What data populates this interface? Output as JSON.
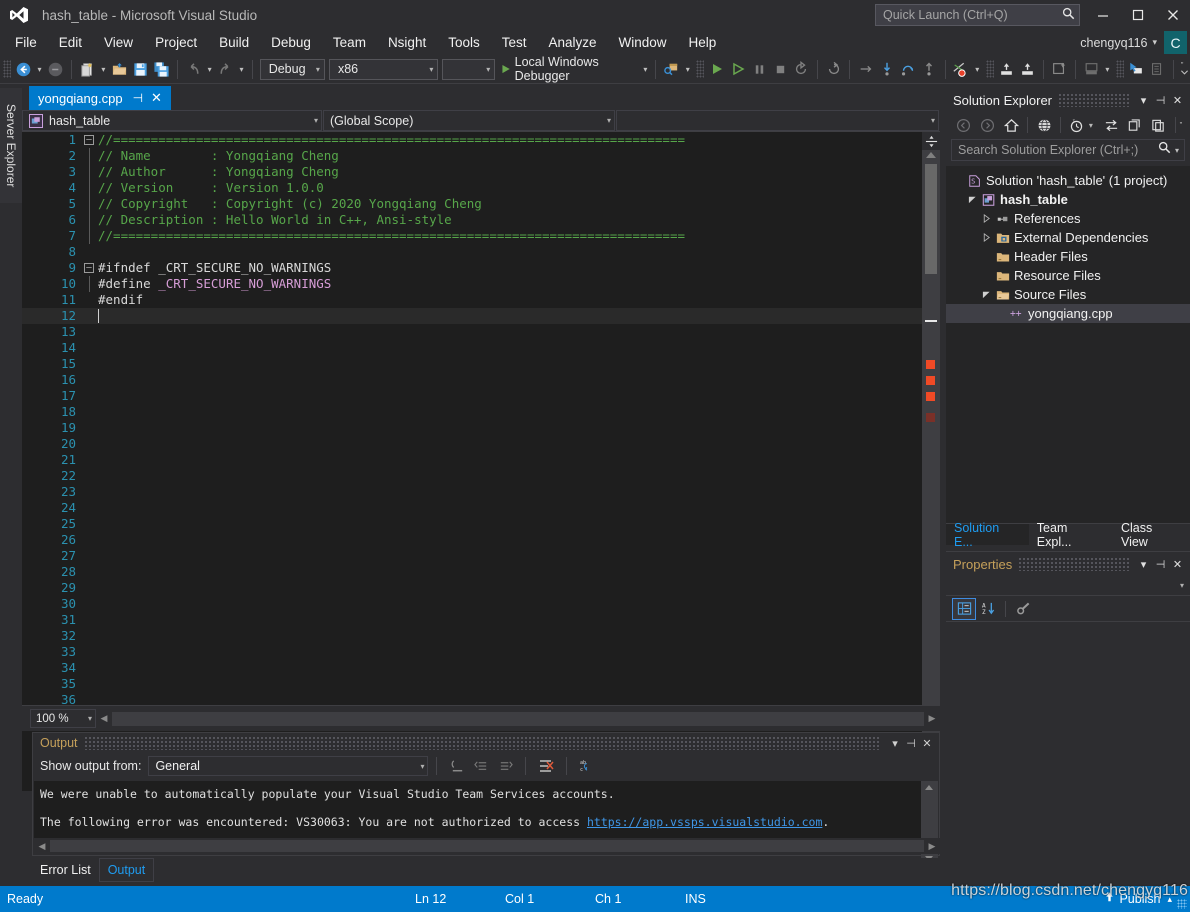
{
  "titlebar": {
    "title": "hash_table - Microsoft Visual Studio",
    "logo_icon": "visual-studio-logo-icon",
    "quick_launch_placeholder": "Quick Launch (Ctrl+Q)",
    "quick_launch_value": "",
    "search_icon": "search-icon",
    "minimize_icon": "minimize-icon",
    "maximize_icon": "maximize-icon",
    "close_icon": "close-icon"
  },
  "menubar": {
    "items": [
      {
        "label": "File"
      },
      {
        "label": "Edit"
      },
      {
        "label": "View"
      },
      {
        "label": "Project"
      },
      {
        "label": "Build"
      },
      {
        "label": "Debug"
      },
      {
        "label": "Team"
      },
      {
        "label": "Nsight"
      },
      {
        "label": "Tools"
      },
      {
        "label": "Test"
      },
      {
        "label": "Analyze"
      },
      {
        "label": "Window"
      },
      {
        "label": "Help"
      }
    ],
    "user_name": "chengyq116",
    "user_caret": "▾",
    "avatar_initial": "C"
  },
  "toolbar": {
    "nav_back_icon": "navigate-back-icon",
    "nav_forward_icon": "navigate-forward-icon",
    "new_project_icon": "new-project-icon",
    "open_file_icon": "open-file-icon",
    "save_icon": "save-icon",
    "save_all_icon": "save-all-icon",
    "undo_icon": "undo-icon",
    "redo_icon": "redo-icon",
    "config_value": "Debug",
    "platform_value": "x86",
    "extra_combo_value": "",
    "run_label": "Local Windows Debugger",
    "run_icon": "start-debug-icon",
    "attach_icon": "attach-to-process-icon",
    "start_icon": "start-icon",
    "start_no_debug_icon": "start-without-debugging-icon",
    "pause_icon": "pause-icon",
    "stop_icon": "stop-icon",
    "restart_icon": "restart-icon",
    "refresh_icon": "refresh-icon",
    "step_over_icon": "step-over-icon",
    "step_into_icon": "step-into-icon",
    "step_out_icon": "step-out-icon",
    "breakpoint_icon": "toggle-breakpoint-icon",
    "indent_in_icon": "indent-icon",
    "indent_out_icon": "outdent-icon",
    "comment_icon": "comment-icon",
    "uncomment_icon": "uncomment-icon",
    "bookmark_icon": "bookmark-icon",
    "list_icon": "list-icon",
    "windows_icon": "windows-icon",
    "misc_icon": "misc-icon"
  },
  "left_dock": {
    "server_explorer_label": "Server Explorer"
  },
  "editor": {
    "tab_name": "yongqiang.cpp",
    "tab_pin_icon": "pin-icon",
    "tab_close_icon": "close-icon",
    "nav_class": "hash_table",
    "nav_class_icon": "class-icon",
    "nav_member": "(Global Scope)",
    "nav_third": "",
    "caret_symbol": "▾",
    "zoom_level": "100 %",
    "scroll_split_icon": "split-view-icon",
    "lines": [
      {
        "n": 1,
        "text": "//============================================================================",
        "cls": "c-comment",
        "fold": "minus"
      },
      {
        "n": 2,
        "text": "// Name        : Yongqiang Cheng",
        "cls": "c-comment",
        "bar": true
      },
      {
        "n": 3,
        "text": "// Author      : Yongqiang Cheng",
        "cls": "c-comment",
        "bar": true
      },
      {
        "n": 4,
        "text": "// Version     : Version 1.0.0",
        "cls": "c-comment",
        "bar": true
      },
      {
        "n": 5,
        "text": "// Copyright   : Copyright (c) 2020 Yongqiang Cheng",
        "cls": "c-comment",
        "bar": true
      },
      {
        "n": 6,
        "text": "// Description : Hello World in C++, Ansi-style",
        "cls": "c-comment",
        "bar": true
      },
      {
        "n": 7,
        "text": "//============================================================================",
        "cls": "c-comment",
        "bar": true
      },
      {
        "n": 8,
        "text": "",
        "cls": "c-pp"
      },
      {
        "n": 9,
        "text": "#ifndef _CRT_SECURE_NO_WARNINGS",
        "cls": "c-pp",
        "fold": "minus"
      },
      {
        "n": 10,
        "text": "#define ",
        "cls": "c-pp",
        "macro": "_CRT_SECURE_NO_WARNINGS",
        "bar": true
      },
      {
        "n": 11,
        "text": "#endif",
        "cls": "c-pp"
      },
      {
        "n": 12,
        "text": "",
        "cls": "c-pp",
        "current": true
      },
      {
        "n": 13,
        "text": ""
      },
      {
        "n": 14,
        "text": ""
      },
      {
        "n": 15,
        "text": ""
      },
      {
        "n": 16,
        "text": ""
      },
      {
        "n": 17,
        "text": ""
      },
      {
        "n": 18,
        "text": ""
      },
      {
        "n": 19,
        "text": ""
      },
      {
        "n": 20,
        "text": ""
      },
      {
        "n": 21,
        "text": ""
      },
      {
        "n": 22,
        "text": ""
      },
      {
        "n": 23,
        "text": ""
      },
      {
        "n": 24,
        "text": ""
      },
      {
        "n": 25,
        "text": ""
      },
      {
        "n": 26,
        "text": ""
      },
      {
        "n": 27,
        "text": ""
      },
      {
        "n": 28,
        "text": ""
      },
      {
        "n": 29,
        "text": ""
      },
      {
        "n": 30,
        "text": ""
      },
      {
        "n": 31,
        "text": ""
      },
      {
        "n": 32,
        "text": ""
      },
      {
        "n": 33,
        "text": ""
      },
      {
        "n": 34,
        "text": ""
      },
      {
        "n": 35,
        "text": ""
      },
      {
        "n": 36,
        "text": ""
      }
    ]
  },
  "solution_explorer": {
    "title": "Solution Explorer",
    "dropdown_icon": "chevron-down-icon",
    "pin_icon": "pin-icon",
    "close_icon": "close-icon",
    "back_icon": "back-icon",
    "forward_icon": "forward-icon",
    "home_icon": "home-icon",
    "all_files_icon": "show-all-files-icon",
    "pending_changes_icon": "pending-changes-icon",
    "sync_icon": "sync-with-active-document-icon",
    "refresh_icon": "refresh-icon",
    "properties_icon": "properties-icon",
    "overflow_icon": "overflow-icon",
    "search_placeholder": "Search Solution Explorer (Ctrl+;)",
    "search_value": "",
    "search_icon": "search-icon",
    "search_caret": "▾",
    "tree": [
      {
        "label": "Solution 'hash_table' (1 project)",
        "indent": 0,
        "expander": "",
        "icon": "solution-icon",
        "bold": false,
        "selected": false
      },
      {
        "label": "hash_table",
        "indent": 1,
        "expander": "expanded",
        "icon": "cpp-project-icon",
        "bold": true,
        "selected": false
      },
      {
        "label": "References",
        "indent": 2,
        "expander": "collapsed",
        "icon": "references-icon",
        "bold": false,
        "selected": false
      },
      {
        "label": "External Dependencies",
        "indent": 2,
        "expander": "collapsed",
        "icon": "folder-dep-icon",
        "bold": false,
        "selected": false
      },
      {
        "label": "Header Files",
        "indent": 2,
        "expander": "",
        "icon": "folder-filter-icon",
        "bold": false,
        "selected": false
      },
      {
        "label": "Resource Files",
        "indent": 2,
        "expander": "",
        "icon": "folder-filter-icon",
        "bold": false,
        "selected": false
      },
      {
        "label": "Source Files",
        "indent": 2,
        "expander": "expanded",
        "icon": "folder-filter-open-icon",
        "bold": false,
        "selected": false
      },
      {
        "label": "yongqiang.cpp",
        "indent": 3,
        "expander": "",
        "icon": "cpp-file-icon",
        "bold": false,
        "selected": true
      }
    ],
    "tabs": [
      {
        "label": "Solution E...",
        "active": true
      },
      {
        "label": "Team Expl...",
        "active": false
      },
      {
        "label": "Class View",
        "active": false
      }
    ]
  },
  "properties": {
    "title": "Properties",
    "dropdown_icon": "chevron-down-icon",
    "pin_icon": "pin-icon",
    "close_icon": "close-icon",
    "filter_caret": "▾",
    "categorized_icon": "categorized-view-icon",
    "alphabetical_icon": "alphabetical-sort-icon",
    "property_pages_icon": "property-pages-icon"
  },
  "output": {
    "title": "Output",
    "dropdown_icon": "chevron-down-icon",
    "pin_icon": "pin-icon",
    "close_icon": "close-icon",
    "show_output_label": "Show output from:",
    "source_value": "General",
    "source_caret": "▾",
    "find_message_icon": "find-message-icon",
    "go_previous_icon": "go-to-previous-message-icon",
    "go_next_icon": "go-to-next-message-icon",
    "clear_all_icon": "clear-all-icon",
    "toggle_wordwrap_icon": "toggle-word-wrap-icon",
    "lines": [
      {
        "text": "We were unable to automatically populate your Visual Studio Team Services accounts.",
        "link": "",
        "tail": ""
      },
      {
        "text": "",
        "link": "",
        "tail": ""
      },
      {
        "text": "The following error was encountered: VS30063: You are not authorized to access ",
        "link": "https://app.vssps.visualstudio.com",
        "tail": "."
      }
    ]
  },
  "bottom_tabs": [
    {
      "label": "Error List",
      "active": false
    },
    {
      "label": "Output",
      "active": true
    }
  ],
  "statusbar": {
    "ready": "Ready",
    "line": "Ln 12",
    "column": "Col 1",
    "character": "Ch 1",
    "insert_mode": "INS",
    "publish_label": "Publish",
    "publish_icon": "publish-icon",
    "publish_caret": "▴"
  },
  "watermark": {
    "text": "https://blog.csdn.net/chengyq116"
  },
  "colors": {
    "accent_blue": "#007acc",
    "chrome_bg": "#2d2d30",
    "editor_bg": "#1e1e1e",
    "tree_bg": "#252526",
    "comment_green": "#57a64a",
    "macro_pink": "#d69dd6",
    "line_number_blue": "#2b91af",
    "link_blue": "#3f97e8",
    "error_red": "#f04a26",
    "folder_gold": "#dcb67a",
    "title_gold": "#c5a05a"
  }
}
